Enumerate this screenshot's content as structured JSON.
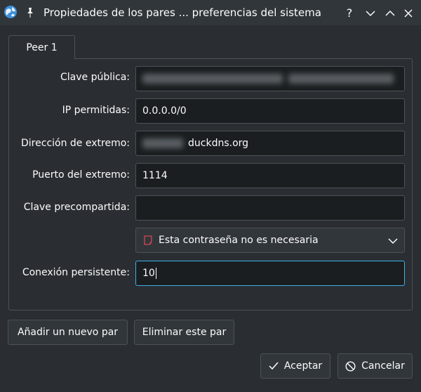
{
  "window": {
    "title": "Propiedades de los pares ... preferencias del sistema",
    "icons": {
      "app": "globe-icon",
      "pin": "pin-icon",
      "help": "help-icon",
      "minimize": "chevron-down-icon",
      "maximize": "chevron-up-icon",
      "close": "close-icon"
    }
  },
  "tabs": [
    {
      "label": "Peer 1"
    }
  ],
  "form": {
    "public_key": {
      "label": "Clave pública:",
      "value": ""
    },
    "allowed_ips": {
      "label": "IP permitidas:",
      "value": "0.0.0.0/0"
    },
    "endpoint_address": {
      "label": "Dirección de extremo:",
      "value": "duckdns.org"
    },
    "endpoint_port": {
      "label": "Puerto del extremo:",
      "value": "1114"
    },
    "preshared_key": {
      "label": "Clave precompartida:",
      "value": ""
    },
    "password_option": {
      "value": "Esta contraseña no es necesaria"
    },
    "persistent_keepalive": {
      "label": "Conexión persistente:",
      "value": "10"
    }
  },
  "actions": {
    "add_peer": "Añadir un nuevo par",
    "remove_peer": "Eliminar este par",
    "ok": "Aceptar",
    "cancel": "Cancelar"
  },
  "colors": {
    "background": "#2a2e32",
    "field": "#1b1e20",
    "border": "#4d5256",
    "focus": "#3daee9",
    "warning": "#da4453"
  }
}
